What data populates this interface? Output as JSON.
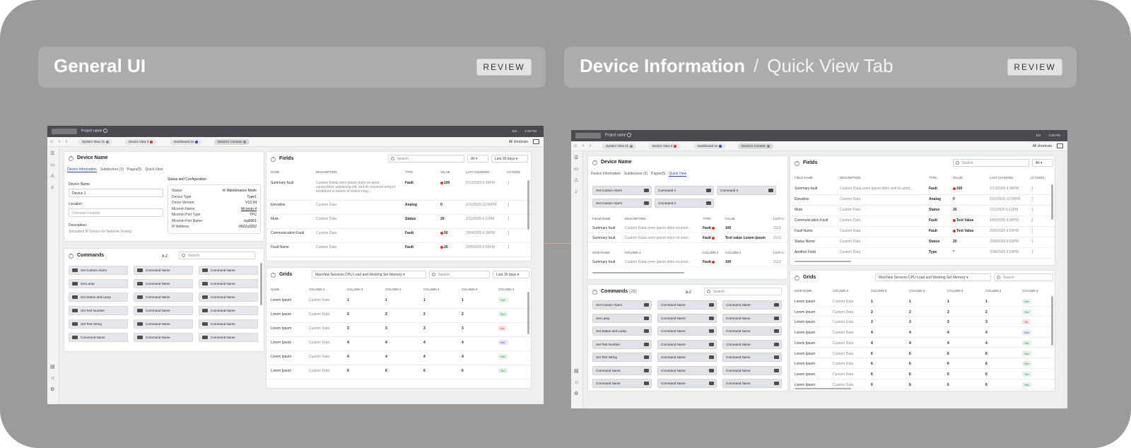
{
  "headers": {
    "left": {
      "title": "General UI",
      "review": "REVIEW"
    },
    "right": {
      "title": "Device Information",
      "separator": "/",
      "subtitle": "Quick View Tab",
      "review": "REVIEW"
    }
  },
  "app": {
    "project": "Project name",
    "lang": "EN",
    "time": "4:39 PM",
    "all_shortcuts": "All shortcuts",
    "tabs": [
      "System View 21",
      "Device View 2",
      "Dashboard 34",
      "Device1 Console"
    ]
  },
  "device_panel": {
    "title": "Device Name",
    "subtabs": [
      "Device Information",
      "Subdevices (3)",
      "Pages(5)",
      "Quick View"
    ],
    "fields": {
      "name_label": "Device Name",
      "name_value": "Device 1",
      "location_label": "Location",
      "location_placeholder": "Unknown location",
      "desc_label": "Description:",
      "desc_value": "Simulated IP Device for Network Testing"
    },
    "status_title": "Status and Configuration",
    "status_rows": [
      {
        "k": "Status:",
        "v": "Maintenance Mode"
      },
      {
        "k": "Device Type",
        "v": "Type1"
      },
      {
        "k": "Driver Version:",
        "v": "V12.34"
      },
      {
        "k": "Mcomm Name",
        "v": "Mcomm 4"
      },
      {
        "k": "Mcomm Port Type",
        "v": "TPC"
      },
      {
        "k": "Mcomm Port Name",
        "v": "tcp6001"
      },
      {
        "k": "IP Address",
        "v": "0922u3202"
      }
    ]
  },
  "commands_left": {
    "title": "Commands",
    "sort": "A-Z",
    "search": "Search",
    "col1": [
      "Set Custom Alarm",
      "Set Lamp",
      "Set Status and Lamp",
      "Set Test Number",
      "Set Test String",
      "Command Name"
    ],
    "col2": [
      "Command Name",
      "Command Name",
      "Command Name",
      "Command Name",
      "Command Name",
      "Command Name"
    ],
    "col3": [
      "Command Name",
      "Command Name",
      "Command Name",
      "Command Name",
      "Command Name",
      "Command Name"
    ]
  },
  "fields_left": {
    "title": "Fields",
    "search": "Search",
    "filter": "All",
    "range": "Last 30 days",
    "headers": [
      "NAME",
      "DESCRIPTION",
      "TYPE",
      "VALUE",
      "LAST CHANGED",
      "ACTIONS"
    ],
    "rows": [
      {
        "name": "Summary fault",
        "desc": "Custom DataLorem ipsum dolor sit amet, consectetur adipiscing elit, sed do eiusmod tempor incididunt ut labore et dolore mag...",
        "type": "Fault",
        "value": "100",
        "date": "2/13/2025 6:36PM"
      },
      {
        "name": "Elevation",
        "desc": "Custom Data",
        "type": "Analog",
        "value": "0",
        "date": "2/11/2025 12:06PM"
      },
      {
        "name": "Mute",
        "desc": "Custom Data",
        "type": "Status",
        "value": "20",
        "date": "2/11/2025 6:11PM"
      },
      {
        "name": "Communication Fault",
        "desc": "Custom Data",
        "type": "Fault",
        "value": "50",
        "date": "2/09/2025 6:36PM"
      },
      {
        "name": "Fault Name",
        "desc": "Custom Data",
        "type": "Fault",
        "value": "20",
        "date": "2/08/2025 9:55PM"
      }
    ]
  },
  "grids_left": {
    "title": "Grids",
    "select": "MaxView Services CPU Load and Working Set Memory",
    "search": "Search",
    "range": "Last 30 days",
    "headers": [
      "NAME",
      "COLUMN 2",
      "COLUMN 3",
      "COLUMN 3",
      "COLUMN 3",
      "COLUMN 3",
      "COLUMN 4"
    ],
    "rows": [
      [
        "Lorem Ipsum",
        "Custom Data",
        "1",
        "1",
        "1",
        "1",
        "Yes"
      ],
      [
        "Lorem Ipsum",
        "Custom Data",
        "2",
        "2",
        "2",
        "2",
        "Yes"
      ],
      [
        "Lorem Ipsum",
        "Custom Data",
        "3",
        "3",
        "3",
        "3",
        "No"
      ],
      [
        "Lorem Ipsum",
        "Custom Data",
        "4",
        "4",
        "4",
        "4",
        "N/A"
      ],
      [
        "Lorem Ipsum",
        "Custom Data",
        "4",
        "4",
        "4",
        "4",
        "Yes"
      ],
      [
        "Lorem Ipsum",
        "Custom Data",
        "6",
        "6",
        "6",
        "6",
        "Yes"
      ]
    ]
  },
  "quick": {
    "title": "Device Name",
    "subtabs": [
      "Device Information",
      "Subdevices (3)",
      "Pages(5)",
      "Quick View"
    ],
    "buttons": [
      "Set Custom Alarm",
      "Command 2",
      "Command 3",
      "Set Custom Alarm",
      "Command 2"
    ],
    "field_headers": [
      "FIELD NAME",
      "DESCRIPTION",
      "TYPE",
      "VALUE",
      "LAST C"
    ],
    "field_rows": [
      {
        "name": "Summary fault",
        "desc": "Custom DataLorem ipsum dolor sit amet...",
        "type": "Fault",
        "value": "100",
        "date": "2/13/"
      },
      {
        "name": "Summary fault",
        "desc": "Custom DataLorem ipsum dolor sit amet...",
        "type": "Fault",
        "value": "Text value Lorem Ipsum",
        "date": "2/13/"
      }
    ],
    "grid_headers": [
      "GRID NAME",
      "COLUMN 1",
      "COLUMN 2",
      "COLUMN 3",
      "LAST C"
    ],
    "grid_rows": [
      {
        "name": "Summary fault",
        "desc": "Custom DataLorem ipsum dolor sit amet...",
        "type": "Fault",
        "value": "100",
        "date": "2/13/"
      }
    ]
  },
  "commands_right": {
    "title": "Commands",
    "count": "(28)",
    "sort": "A-Z",
    "search": "Search",
    "col1": [
      "Set Custom Alarm",
      "Set Lamp",
      "Set Status and Lamp",
      "Set Test Number",
      "Set Test String",
      "Command Name",
      "Command Name"
    ],
    "col2": [
      "Command Name",
      "Command Name",
      "Command Name",
      "Command Name",
      "Command Name",
      "Command Name",
      "Command Name"
    ],
    "col3": [
      "Command Name",
      "Command Name",
      "Command Name",
      "Command Name",
      "Command Name",
      "Command Name",
      "Command Name"
    ]
  },
  "fields_right": {
    "title": "Fields",
    "search": "Search",
    "filter": "All",
    "headers": [
      "FIELD NAME",
      "DESCRIPTION",
      "TYPE",
      "VALUE",
      "LAST CHANGED",
      "ACTIONS"
    ],
    "rows": [
      {
        "name": "Summary fault",
        "desc": "Custom DataLorem ipsum dolor and sit amet...",
        "type": "Fault",
        "value": "100",
        "date": "2/13/2025 6:36PM"
      },
      {
        "name": "Elevation",
        "desc": "Custom Data",
        "type": "Analog",
        "value": "0",
        "date": "2/11/2025 12:06PM"
      },
      {
        "name": "Mute",
        "desc": "Custom Data",
        "type": "Status",
        "value": "20",
        "date": "2/11/2025 6:11PM"
      },
      {
        "name": "Communication Fault",
        "desc": "Custom Data",
        "type": "Fault",
        "value": "Text Value",
        "date": "2/09/2025 6:36PM"
      },
      {
        "name": "Fault Name",
        "desc": "Custom Data",
        "type": "Fault",
        "value": "Text Value",
        "date": "2/09/2025 9:55PM"
      },
      {
        "name": "Status Name",
        "desc": "Custom Data",
        "type": "Status",
        "value": "20",
        "date": "2/08/2025 9:55PM"
      },
      {
        "name": "Another Field",
        "desc": "Custom Data",
        "type": "Type",
        "value": "*",
        "date": "2/08/2025 9:55PM"
      }
    ]
  },
  "grids_right": {
    "title": "Grids",
    "select": "MaxView Services CPU Load and Working Set Memory",
    "search": "Search",
    "headers": [
      "GRID NAME",
      "COLUMN 2",
      "COLUMN 3",
      "COLUMN 3",
      "COLUMN 3",
      "COLUMN 3",
      "COLUMN 4"
    ],
    "rows": [
      [
        "Lorem Ipsum",
        "Custom Data",
        "1",
        "1",
        "1",
        "1",
        "Yes"
      ],
      [
        "Lorem Ipsum",
        "Custom Data",
        "2",
        "2",
        "2",
        "2",
        "Yes"
      ],
      [
        "Lorem Ipsum",
        "Custom Data",
        "3",
        "3",
        "3",
        "3",
        "No"
      ],
      [
        "Lorem Ipsum",
        "Custom Data",
        "4",
        "4",
        "4",
        "4",
        "N/A"
      ],
      [
        "Lorem Ipsum",
        "Custom Data",
        "4",
        "4",
        "4",
        "4",
        "Yes"
      ],
      [
        "Lorem Ipsum",
        "Custom Data",
        "6",
        "6",
        "6",
        "6",
        "Yes"
      ],
      [
        "Lorem Ipsum",
        "Custom Data",
        "6",
        "6",
        "6",
        "6",
        "Yes"
      ],
      [
        "Lorem Ipsum",
        "Custom Data",
        "6",
        "6",
        "6",
        "6",
        "Yes"
      ],
      [
        "Lorem Ipsum",
        "Custom Data",
        "0",
        "6",
        "6",
        "6",
        "Yes"
      ]
    ]
  },
  "colors": {
    "board": "#9b9b9b",
    "accent": "#2848b8",
    "fault": "#d9342b",
    "yes_bg": "#dff3e4",
    "yes_fg": "#2e8b4b",
    "no_bg": "#fbe0e0",
    "no_fg": "#c63131",
    "na_bg": "#ece4fb",
    "na_fg": "#6a3fc4"
  }
}
